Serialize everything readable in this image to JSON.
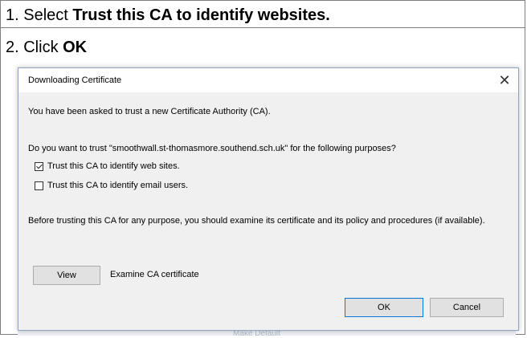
{
  "instructions": {
    "step1_prefix": "1. Select ",
    "step1_bold": "Trust this CA to identify websites.",
    "step2_prefix": "2. Click ",
    "step2_bold": "OK"
  },
  "dialog": {
    "title": "Downloading Certificate",
    "close_glyph": "✕",
    "intro": "You have been asked to trust a new Certificate Authority (CA).",
    "question": "Do you want to trust \"smoothwall.st-thomasmore.southend.sch.uk\" for the following purposes?",
    "options": [
      {
        "label": "Trust this CA to identify web sites.",
        "checked": true
      },
      {
        "label": "Trust this CA to identify email users.",
        "checked": false
      }
    ],
    "advice": "Before trusting this CA for any purpose, you should examine its certificate and its policy and procedures (if available).",
    "view_button": "View",
    "examine_label": "Examine CA certificate",
    "ok_button": "OK",
    "cancel_button": "Cancel"
  },
  "background": {
    "partial_text": "Make Default"
  }
}
